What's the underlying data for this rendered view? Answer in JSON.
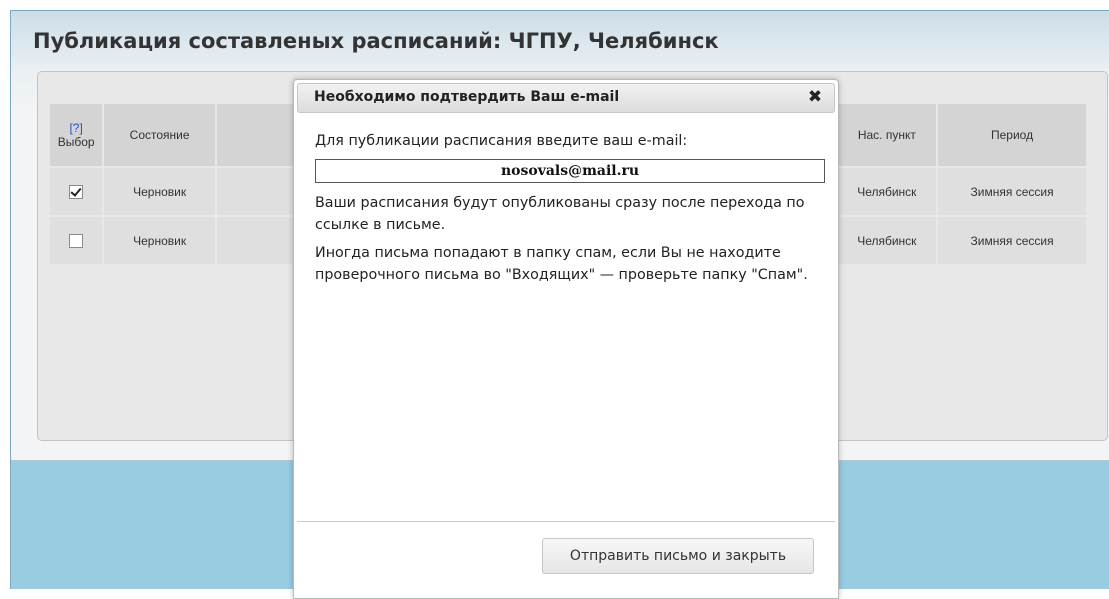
{
  "page": {
    "title": "Публикация составленых расписаний: ЧГПУ, Челябинск"
  },
  "table": {
    "columns": {
      "help": "[?]",
      "select": "Выбор",
      "status": "Состояние",
      "city": "Нас. пункт",
      "period": "Период"
    },
    "rows": [
      {
        "checked": true,
        "status": "Черновик",
        "city": "Челябинск",
        "period": "Зимняя сессия"
      },
      {
        "checked": false,
        "status": "Черновик",
        "city": "Челябинск",
        "period": "Зимняя сессия"
      }
    ]
  },
  "dialog": {
    "title": "Необходимо подтвердить Ваш e-mail",
    "close_icon": "close-icon",
    "prompt": "Для публикации расписания введите ваш e-mail:",
    "email_value": "nosovals@mail.ru",
    "note1": "Ваши расписания будут опубликованы сразу после перехода по ссылке в письме.",
    "note2": "Иногда письма попадают в папку спам, если Вы не находите проверочного письма во \"Входящих\" — проверьте папку \"Спам\".",
    "send_button": "Отправить письмо и закрыть"
  },
  "colors": {
    "background": "#97cce1",
    "panel": "#e8e8e8",
    "link": "#2a4fc1"
  }
}
